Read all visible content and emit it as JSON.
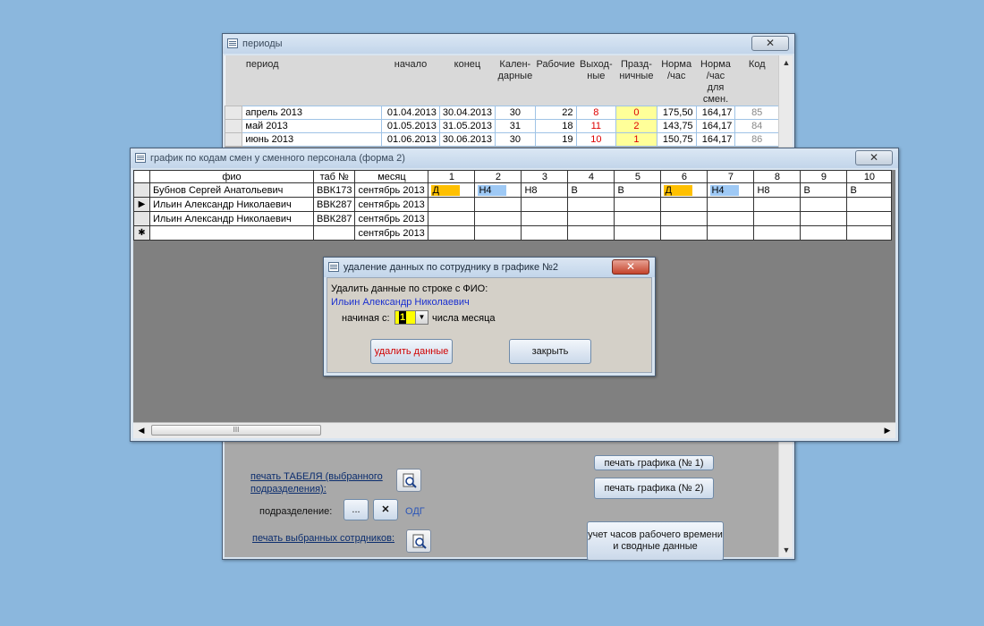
{
  "periods_window": {
    "title": "периоды",
    "close_label": "✕",
    "headers": [
      "период",
      "начало",
      "конец",
      "Кален-\nдарные",
      "Рабочие",
      "Выход-\nные",
      "Празд-\nничные",
      "Норма\n/час",
      "Норма\n/час\nдля\nсмен.",
      "Код"
    ],
    "rows": [
      {
        "period": "апрель 2013",
        "start": "01.04.2013",
        "end": "30.04.2013",
        "calendar": "30",
        "working": "22",
        "weekend": "8",
        "holiday": "0",
        "norm": "175,50",
        "norm_shift": "164,17",
        "code": "85"
      },
      {
        "period": "май 2013",
        "start": "01.05.2013",
        "end": "31.05.2013",
        "calendar": "31",
        "working": "18",
        "weekend": "11",
        "holiday": "2",
        "norm": "143,75",
        "norm_shift": "164,17",
        "code": "84"
      },
      {
        "period": "июнь 2013",
        "start": "01.06.2013",
        "end": "30.06.2013",
        "calendar": "30",
        "working": "19",
        "weekend": "10",
        "holiday": "1",
        "norm": "150,75",
        "norm_shift": "164,17",
        "code": "86"
      }
    ],
    "lower": {
      "print_timesheet_label": "печать ТАБЕЛЯ (выбранного подразделения):",
      "division_label": "подразделение:",
      "division_browse": "...",
      "division_clear": "✕",
      "division_value": "ОДГ",
      "print_selected_label": "печать выбранных сотрдников:",
      "print_schedule1": "печать графика (№ 1)",
      "print_schedule2": "печать графика (№ 2)",
      "hours_button": "учет часов рабочего времени и сводные данные"
    }
  },
  "grid_window": {
    "title": "график по кодам смен у сменного персонала (форма 2)",
    "close_label": "✕",
    "headers": [
      "фио",
      "таб №",
      "месяц",
      "1",
      "2",
      "3",
      "4",
      "5",
      "6",
      "7",
      "8",
      "9",
      "10"
    ],
    "rows": [
      {
        "marker": "",
        "name": "Бубнов Сергей Анатольевич",
        "tab": "ВВК173",
        "month": "сентябрь 2013",
        "days": [
          "Д",
          "Н4",
          "Н8",
          "В",
          "В",
          "Д",
          "Н4",
          "Н8",
          "В",
          "В"
        ]
      },
      {
        "marker": "▶",
        "name": "Ильин Александр Николаевич",
        "tab": "ВВК287",
        "month": "сентябрь 2013",
        "days": [
          "",
          "",
          "",
          "",
          "",
          "",
          "",
          "",
          "",
          ""
        ]
      },
      {
        "marker": "",
        "name": "Ильин Александр Николаевич",
        "tab": "ВВК287",
        "month": "сентябрь 2013",
        "days": [
          "",
          "",
          "",
          "",
          "",
          "",
          "",
          "",
          "",
          ""
        ]
      },
      {
        "marker": "✱",
        "name": "",
        "tab": "",
        "month": "сентябрь 2013",
        "days": [
          "",
          "",
          "",
          "",
          "",
          "",
          "",
          "",
          "",
          ""
        ]
      }
    ],
    "scroll_thumb": "III"
  },
  "dialog": {
    "title": "удаление данных по сотруднику в графике №2",
    "close_label": "✕",
    "prompt": "Удалить данные по строке с ФИО:",
    "employee": "Ильин Александр Николаевич",
    "starting_label": "начиная с:",
    "starting_value": "1",
    "suffix": "числа месяца",
    "delete_button": "удалить данные",
    "close_button": "закрыть"
  },
  "colors": {
    "day_orange": "#ffc000",
    "night_blue": "#9ec9f5",
    "desktop": "#8bb7dd"
  }
}
